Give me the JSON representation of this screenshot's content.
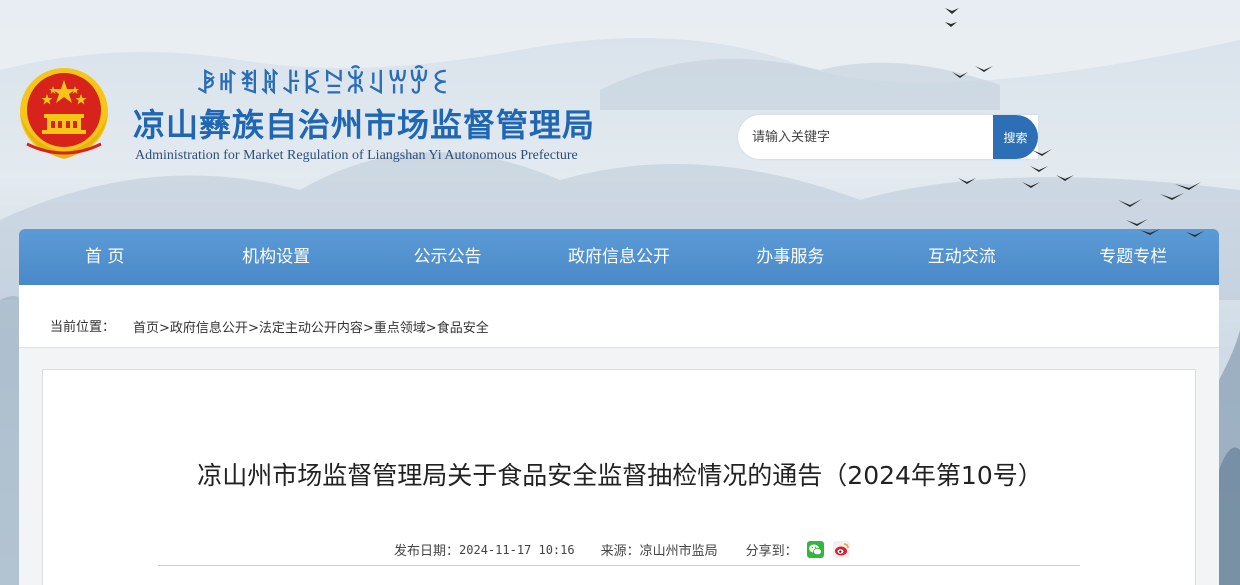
{
  "header": {
    "yi_script": "ꆃꎭꄮꍩꌠꌅꊂꍜꆹꀕꏭꏂ",
    "title": "凉山彝族自治州市场监督管理局",
    "subtitle": "Administration for Market Regulation of Liangshan Yi Autonomous Prefecture"
  },
  "search": {
    "placeholder": "请输入关键字",
    "button_label": "搜索"
  },
  "nav": {
    "items": [
      {
        "label": "首 页"
      },
      {
        "label": "机构设置"
      },
      {
        "label": "公示公告"
      },
      {
        "label": "政府信息公开"
      },
      {
        "label": "办事服务"
      },
      {
        "label": "互动交流"
      },
      {
        "label": "专题专栏"
      }
    ]
  },
  "breadcrumb": {
    "label": "当前位置：",
    "items": [
      "首页",
      "政府信息公开",
      "法定主动公开内容",
      "重点领域",
      "食品安全"
    ],
    "separator": ">"
  },
  "article": {
    "title": "凉山州市场监督管理局关于食品安全监督抽检情况的通告（2024年第10号）",
    "date_label": "发布日期：",
    "date_value": "2024-11-17 10:16",
    "source_label": "来源：",
    "source_value": "凉山州市监局",
    "share_label": "分享到："
  },
  "icons": {
    "emblem": "national-emblem-icon",
    "wechat": "wechat-icon",
    "weibo": "weibo-icon"
  },
  "colors": {
    "brand_blue": "#1f66b3",
    "nav_blue": "#4a89c8",
    "emblem_red": "#d7231b",
    "emblem_gold": "#f5c518"
  }
}
